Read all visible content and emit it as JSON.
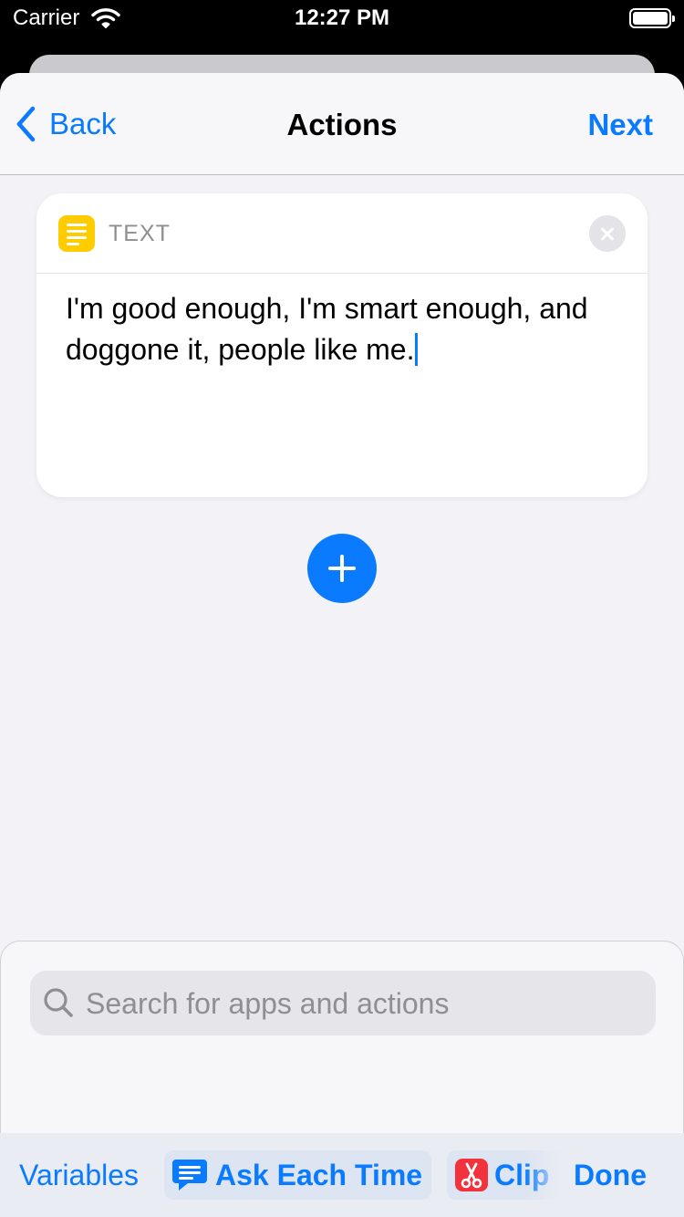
{
  "status_bar": {
    "carrier": "Carrier",
    "time": "12:27 PM",
    "icons": [
      "wifi-icon",
      "battery-icon"
    ]
  },
  "nav": {
    "back_label": "Back",
    "title": "Actions",
    "next_label": "Next",
    "accent_color": "#0a7aff"
  },
  "action_card": {
    "icon": "text-lines-icon",
    "icon_color": "#ffcc00",
    "label": "TEXT",
    "content": "I'm good enough, I'm smart enough, and doggone it, people like me."
  },
  "search": {
    "placeholder": "Search for apps and actions"
  },
  "accessory_bar": {
    "variables_label": "Variables",
    "ask_each_time_label": "Ask Each Time",
    "clipboard_label": "Clip",
    "done_label": "Done"
  }
}
